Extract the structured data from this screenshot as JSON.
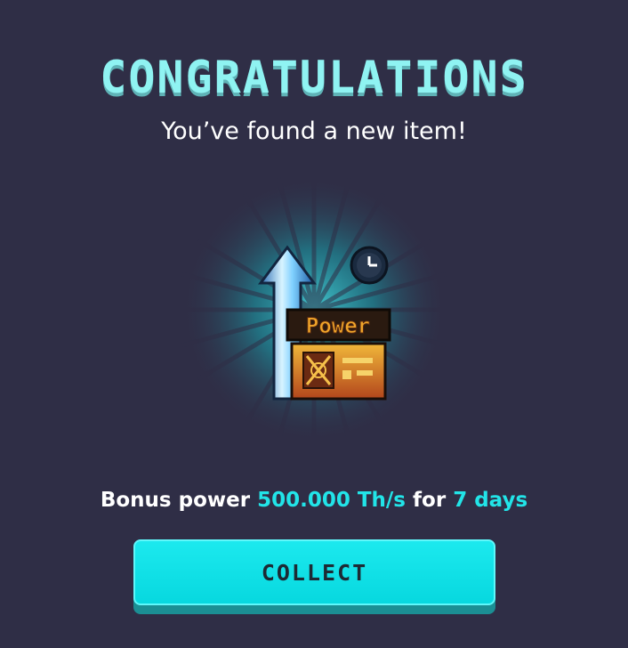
{
  "dialog": {
    "title": "CONGRATULATIONS",
    "subtitle": "You’ve found a new item!",
    "item": {
      "label": "Power",
      "icons": [
        "up-arrow-icon",
        "clock-icon",
        "power-supply-icon"
      ],
      "colors": {
        "glow": "#23c9cf",
        "arrow": "#6fd2ff",
        "badge": "#e9a11f"
      }
    },
    "reward": {
      "prefix": "Bonus power",
      "power": "500.000 Th/s",
      "middle": "for",
      "duration": "7 days"
    },
    "collect_label": "COLLECT"
  },
  "colors": {
    "background": "#2f2e46",
    "title": "#8ff3f2",
    "accent": "#22e4e8",
    "button": "#07d8df"
  }
}
